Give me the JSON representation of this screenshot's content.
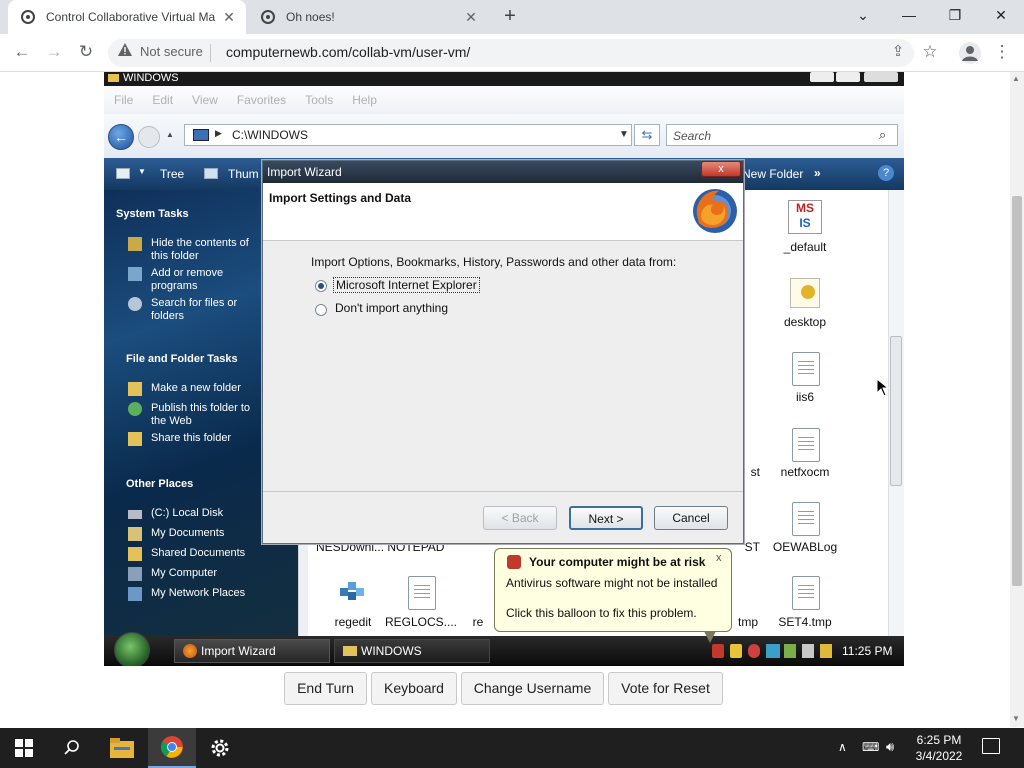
{
  "browser": {
    "tabs": [
      {
        "title": "Control Collaborative Virtual Ma"
      },
      {
        "title": "Oh noes!"
      }
    ],
    "new_tab_symbol": "+",
    "not_secure": "Not secure",
    "url": "computernewb.com/collab-vm/user-vm/"
  },
  "vm": {
    "explorer": {
      "title": "WINDOWS",
      "menu": [
        "File",
        "Edit",
        "View",
        "Favorites",
        "Tools",
        "Help"
      ],
      "address": "C:\\WINDOWS",
      "search_placeholder": "Search",
      "links_bar": {
        "tree": "Tree",
        "thumb": "Thum",
        "new_folder": "New Folder",
        "more": "»"
      },
      "system_tasks": {
        "heading": "System Tasks",
        "items": [
          "Hide the contents of this folder",
          "Add or remove programs",
          "Search for files or folders"
        ]
      },
      "file_folder_tasks": {
        "heading": "File and Folder Tasks",
        "items": [
          "Make a new folder",
          "Publish this folder to the Web",
          "Share this folder"
        ]
      },
      "other_places": {
        "heading": "Other Places",
        "items": [
          "(C:) Local Disk",
          "My Documents",
          "Shared Documents",
          "My Computer",
          "My Network Places"
        ]
      },
      "files": {
        "default": "_default",
        "desktop": "desktop",
        "iis6": "iis6",
        "netfxocm": "netfxocm",
        "oewablog": "OEWABLog",
        "regedit": "regedit",
        "reglocs": "REGLOCS....",
        "set4": "SET4.tmp",
        "partial_st": "st",
        "partial_st2": "ST",
        "partial_re": "re",
        "partial_tmp": "tmp",
        "partial_row": "NESDowni...   NOTEPAD"
      }
    },
    "import_wizard": {
      "title": "Import Wizard",
      "close_label": "x",
      "heading": "Import Settings and Data",
      "prompt": "Import Options, Bookmarks, History, Passwords and other data from:",
      "options": [
        {
          "label": "Microsoft Internet Explorer",
          "selected": true
        },
        {
          "label": "Don't import anything",
          "selected": false
        }
      ],
      "back_label": "< Back",
      "next_label": "Next >",
      "cancel_label": "Cancel"
    },
    "balloon": {
      "title": "Your computer might be at risk",
      "line1": "Antivirus software might not be installed",
      "line2": "Click this balloon to fix this problem.",
      "close_label": "x"
    },
    "taskbar": {
      "tasks": [
        {
          "label": "Import Wizard"
        },
        {
          "label": "WINDOWS"
        }
      ],
      "clock": "11:25 PM"
    }
  },
  "page_buttons": {
    "end_turn": "End Turn",
    "keyboard": "Keyboard",
    "change_username": "Change Username",
    "vote_reset": "Vote for Reset"
  },
  "host_taskbar": {
    "time": "6:25 PM",
    "date": "3/4/2022"
  },
  "colors": {
    "chrome_tabbar": "#dee1e6",
    "vm_links_bar": "#1f4a7a",
    "balloon_bg": "#ffffe1",
    "host_taskbar": "#1f1f1f"
  },
  "icons": [
    "chrome-favicon",
    "back-arrow-icon",
    "forward-arrow-icon",
    "reload-icon",
    "warning-icon",
    "share-icon",
    "star-icon",
    "profile-icon",
    "more-icon",
    "firefox-icon",
    "shield-warning-icon",
    "windows-start-icon",
    "search-icon",
    "file-explorer-icon",
    "chrome-icon",
    "gear-icon",
    "notification-icon"
  ]
}
